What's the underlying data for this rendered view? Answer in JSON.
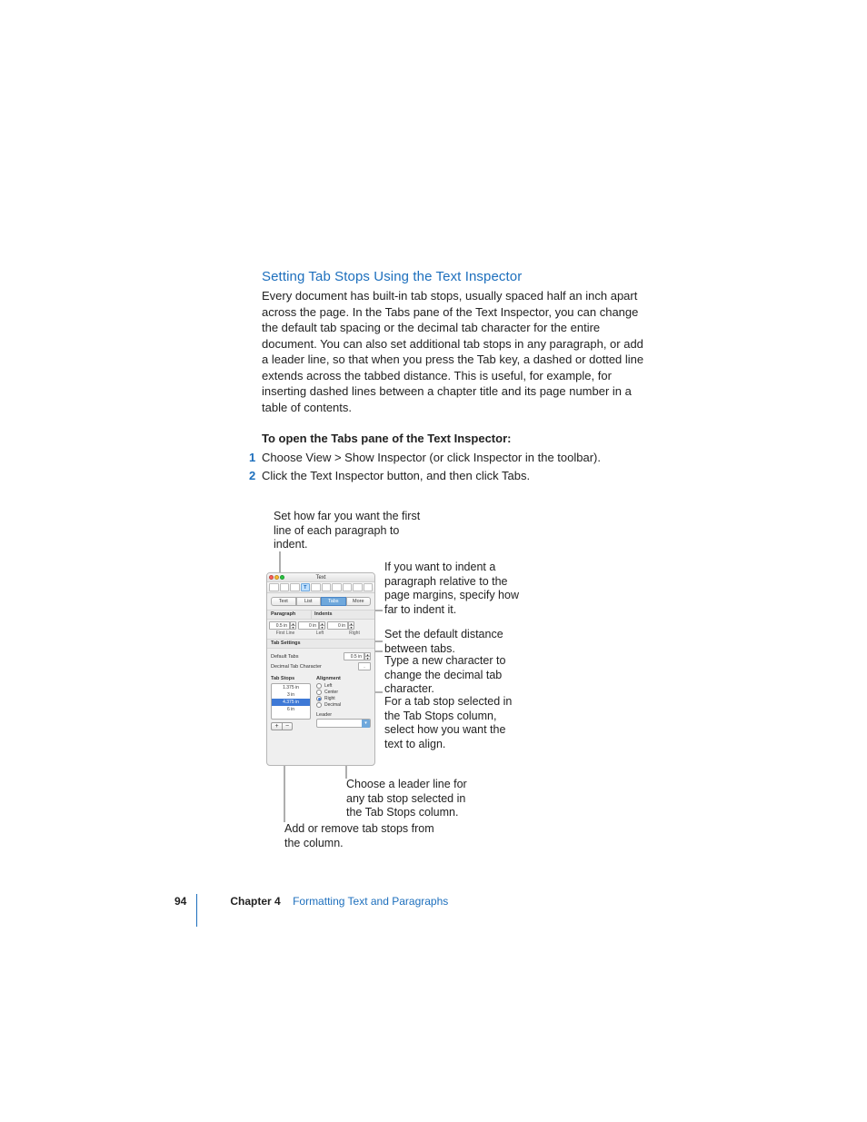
{
  "section_title": "Setting Tab Stops Using the Text Inspector",
  "intro": "Every document has built-in tab stops, usually spaced half an inch apart across the page. In the Tabs pane of the Text Inspector, you can change the default tab spacing or the decimal tab character for the entire document. You can also set additional tab stops in any paragraph, or add a leader line, so that when you press the Tab key, a dashed or dotted line extends across the tabbed distance. This is useful, for example, for inserting dashed lines between a chapter title and its page number in a table of contents.",
  "howto_title": "To open the Tabs pane of the Text Inspector:",
  "steps": [
    "Choose View > Show Inspector (or click Inspector in the toolbar).",
    "Click the Text Inspector button, and then click Tabs."
  ],
  "panel": {
    "title": "Text",
    "subtabs": [
      "Text",
      "List",
      "Tabs",
      "More"
    ],
    "selected_subtab_index": 2,
    "section_paragraph": "Paragraph",
    "section_indents": "Indents",
    "indent_first": "0.5 in",
    "indent_left": "0 in",
    "indent_right": "0 in",
    "label_first": "First Line",
    "label_left": "Left",
    "label_right": "Right",
    "section_tabsettings": "Tab Settings",
    "label_default_tabs": "Default Tabs",
    "default_tabs_value": "0.5 in",
    "label_decimal_char": "Decimal Tab Character",
    "decimal_char": ".",
    "label_tabstops": "Tab Stops",
    "label_alignment": "Alignment",
    "tab_stops": [
      "1.375 in",
      "3 in",
      "4.375 in",
      "6 in"
    ],
    "tab_stops_selected_index": 2,
    "align_options": [
      "Left",
      "Center",
      "Right",
      "Decimal"
    ],
    "align_selected_index": 2,
    "label_leader": "Leader",
    "leader_value": "",
    "icon_add": "+",
    "icon_remove": "−"
  },
  "callouts": {
    "top": "Set how far you want the first line of each paragraph to indent.",
    "r1": "If you want to indent a paragraph relative to the page margins, specify how far to indent it.",
    "r2": "Set the default distance between tabs.",
    "r3": "Type a new character to change the decimal tab character.",
    "r4": "For a tab stop selected in the Tab Stops column, select how you want the text to align.",
    "bottom_right": "Choose a leader line for any tab stop selected in the Tab Stops column.",
    "bottom_left": "Add or remove tab stops from the column."
  },
  "footer": {
    "page": "94",
    "chapter_label": "Chapter 4",
    "chapter_title": "Formatting Text and Paragraphs"
  }
}
